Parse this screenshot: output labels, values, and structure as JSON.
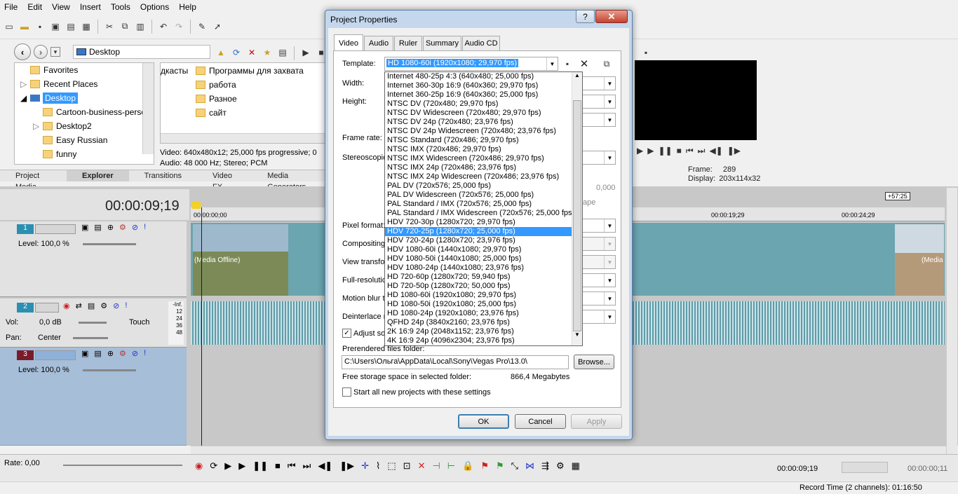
{
  "menu": [
    "File",
    "Edit",
    "View",
    "Insert",
    "Tools",
    "Options",
    "Help"
  ],
  "explorer": {
    "address": "Desktop",
    "tree": [
      "Favorites",
      "Recent Places",
      "Desktop",
      "Cartoon-business-perso",
      "Desktop2",
      "Easy Russian",
      "funny"
    ],
    "files_col1": [
      "Программы для захвата",
      "работа",
      "Разное",
      "сайт"
    ],
    "files_col0": "дкасты",
    "info_line1": "Video: 640x480x12; 25,000 fps progressive; 0",
    "info_line2": "Audio: 48 000 Hz; Stereo; PCM"
  },
  "bottom_tabs": [
    "Project Media",
    "Explorer",
    "Transitions",
    "Video FX",
    "Media Generators"
  ],
  "preview": {
    "frame_label": "Frame:",
    "frame_value": "289",
    "display_label": "Display:",
    "display_value": "203x114x32"
  },
  "timeline": {
    "timecode": "00:00:09;19",
    "ruler_marks": [
      "00:00:00;00",
      "00:00:19;29",
      "00:00:24;29"
    ],
    "end_badge": "+57:25",
    "track1": {
      "num": "1",
      "level": "Level: 100,0 %",
      "media_offline": "(Media Offline)",
      "media_offline2": "(Media"
    },
    "track2": {
      "num": "2",
      "vol_label": "Vol:",
      "vol_value": "0,0 dB",
      "pan_label": "Pan:",
      "pan_value": "Center",
      "touch": "Touch",
      "meter": [
        "-Inf.",
        "12",
        "24",
        "36",
        "48"
      ]
    },
    "track3": {
      "num": "3",
      "level": "Level: 100,0 %"
    },
    "rate": "Rate: 0,00",
    "right_value_label": "0,000",
    "ape": "ape"
  },
  "transport": {
    "time1": "00:00:09;19",
    "time2": "00:00:00;11"
  },
  "status": {
    "record_time": "Record Time (2 channels): 01:16:50"
  },
  "dialog": {
    "title": "Project Properties",
    "help": "?",
    "close": "✕",
    "tabs": [
      "Video",
      "Audio",
      "Ruler",
      "Summary",
      "Audio CD"
    ],
    "labels": {
      "template": "Template:",
      "width": "Width:",
      "height": "Height:",
      "frame_rate": "Frame rate:",
      "stereoscopic": "Stereoscopic",
      "pixel_format": "Pixel format:",
      "compositing": "Compositing",
      "view_transform": "View transfor",
      "full_resolution": "Full-resolution",
      "motion_blur": "Motion blur ty",
      "deinterlace": "Deinterlace r",
      "adjust_source": "Adjust sou",
      "prerendered": "Prerendered files folder:",
      "free_storage": "Free storage space in selected folder:",
      "start_all": "Start all new projects with these settings"
    },
    "template_value": "HD 1080-60i (1920x1080; 29,970 fps)",
    "folder_path": "C:\\Users\\Ольга\\AppData\\Local\\Sony\\Vegas Pro\\13.0\\",
    "browse": "Browse...",
    "free_storage_value": "866,4 Megabytes",
    "ok": "OK",
    "cancel": "Cancel",
    "apply": "Apply",
    "template_options": [
      "Internet 480-25p 4:3 (640x480; 25,000 fps)",
      "Internet 360-30p 16:9 (640x360; 29,970 fps)",
      "Internet 360-25p 16:9 (640x360; 25,000 fps)",
      "NTSC DV (720x480; 29,970 fps)",
      "NTSC DV Widescreen (720x480; 29,970 fps)",
      "NTSC DV 24p (720x480; 23,976 fps)",
      "NTSC DV 24p Widescreen (720x480; 23,976 fps)",
      "NTSC Standard (720x486; 29,970 fps)",
      "NTSC IMX (720x486; 29,970 fps)",
      "NTSC IMX Widescreen (720x486; 29,970 fps)",
      "NTSC IMX 24p (720x486; 23,976 fps)",
      "NTSC IMX 24p Widescreen (720x486; 23,976 fps)",
      "PAL DV (720x576; 25,000 fps)",
      "PAL DV Widescreen (720x576; 25,000 fps)",
      "PAL Standard / IMX (720x576; 25,000 fps)",
      "PAL Standard / IMX Widescreen (720x576; 25,000 fps)",
      "HDV 720-30p (1280x720; 29,970 fps)",
      "HDV 720-25p (1280x720; 25,000 fps)",
      "HDV 720-24p (1280x720; 23,976 fps)",
      "HDV 1080-60i (1440x1080; 29,970 fps)",
      "HDV 1080-50i (1440x1080; 25,000 fps)",
      "HDV 1080-24p (1440x1080; 23,976 fps)",
      "HD 720-60p (1280x720; 59,940 fps)",
      "HD 720-50p (1280x720; 50,000 fps)",
      "HD 1080-60i (1920x1080; 29,970 fps)",
      "HD 1080-50i (1920x1080; 25,000 fps)",
      "HD 1080-24p (1920x1080; 23,976 fps)",
      "QFHD 24p (3840x2160; 23,976 fps)",
      "2K 16:9 24p (2048x1152; 23,976 fps)",
      "4K 16:9 24p (4096x2304; 23,976 fps)"
    ],
    "selected_option_index": 17
  }
}
